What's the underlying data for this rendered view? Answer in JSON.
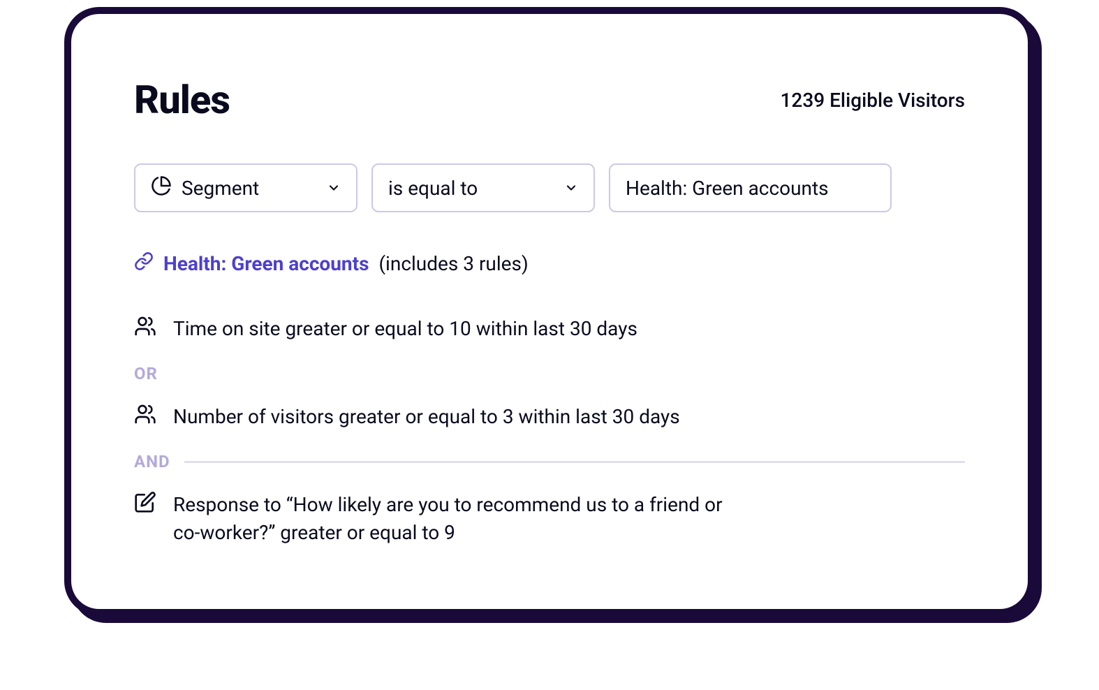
{
  "header": {
    "title": "Rules",
    "eligible_count": "1239",
    "eligible_label": "Eligible Visitors"
  },
  "selectors": {
    "attribute": "Segment",
    "operator": "is equal to",
    "value": "Health: Green accounts"
  },
  "segment_link": {
    "name": "Health: Green accounts",
    "suffix": "(includes 3 rules)"
  },
  "rules": [
    {
      "icon": "visitors",
      "text": "Time on site greater or equal to 10 within last 30 days"
    },
    {
      "icon": "visitors",
      "text": "Number of visitors greater or equal to 3 within last 30 days"
    },
    {
      "icon": "response",
      "text": "Response to “How likely are you to recommend us to a friend or co-worker?” greater or equal to 9"
    }
  ],
  "connectors": {
    "or": "OR",
    "and": "AND"
  }
}
